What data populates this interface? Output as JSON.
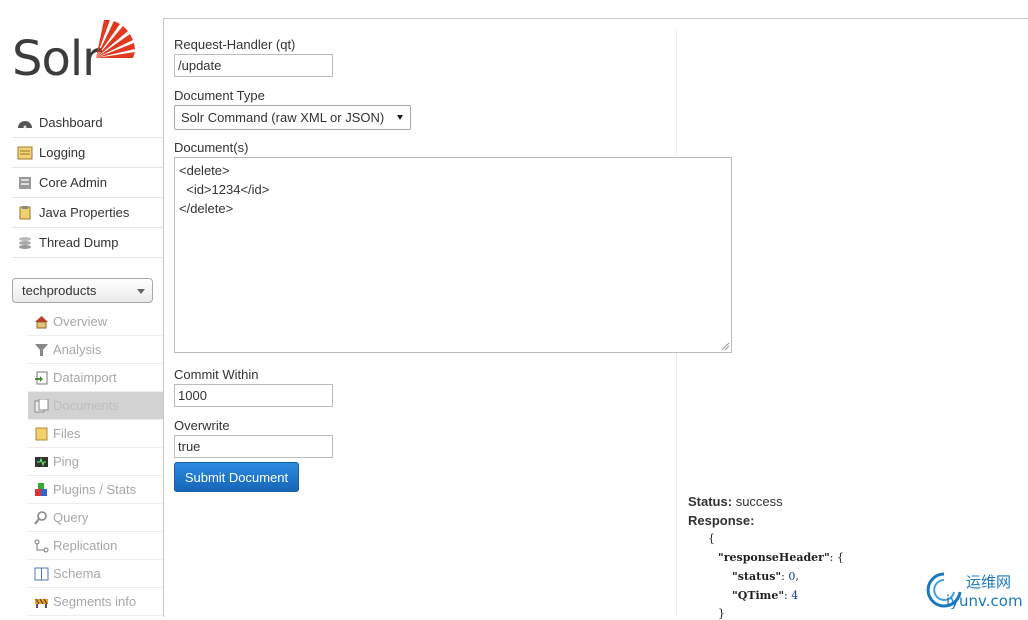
{
  "logo": {
    "text": "Solr"
  },
  "nav": [
    {
      "label": "Dashboard",
      "icon": "dashboard-icon"
    },
    {
      "label": "Logging",
      "icon": "logging-icon"
    },
    {
      "label": "Core Admin",
      "icon": "core-admin-icon"
    },
    {
      "label": "Java Properties",
      "icon": "java-properties-icon"
    },
    {
      "label": "Thread Dump",
      "icon": "thread-dump-icon"
    }
  ],
  "core_selector": {
    "value": "techproducts"
  },
  "core_nav": [
    {
      "label": "Overview",
      "icon": "home-icon"
    },
    {
      "label": "Analysis",
      "icon": "funnel-icon"
    },
    {
      "label": "Dataimport",
      "icon": "dataimport-icon"
    },
    {
      "label": "Documents",
      "icon": "documents-icon",
      "active": true
    },
    {
      "label": "Files",
      "icon": "folder-icon"
    },
    {
      "label": "Ping",
      "icon": "ping-icon"
    },
    {
      "label": "Plugins / Stats",
      "icon": "plugins-icon"
    },
    {
      "label": "Query",
      "icon": "query-icon"
    },
    {
      "label": "Replication",
      "icon": "replication-icon"
    },
    {
      "label": "Schema",
      "icon": "schema-icon"
    },
    {
      "label": "Segments info",
      "icon": "segments-icon"
    }
  ],
  "form": {
    "request_handler_label": "Request-Handler (qt)",
    "request_handler_value": "/update",
    "document_type_label": "Document Type",
    "document_type_value": "Solr Command (raw XML or JSON)",
    "documents_label": "Document(s)",
    "documents_lines": [
      "<delete>",
      "  <id>1234</id>",
      "</delete>"
    ],
    "commit_within_label": "Commit Within",
    "commit_within_value": "1000",
    "overwrite_label": "Overwrite",
    "overwrite_value": "true",
    "submit_label": "Submit Document"
  },
  "response": {
    "status_label": "Status:",
    "status_value": "success",
    "response_label": "Response:",
    "open_brace": "{",
    "header_key": "\"responseHeader\"",
    "header_open": ": {",
    "status_key": "\"status\"",
    "status_num": "0",
    "qtime_key": "\"QTime\"",
    "qtime_num": "4",
    "close_brace": "}"
  },
  "watermark": {
    "cn": "运维网",
    "en": "iyunv.com"
  },
  "colors": {
    "accent": "#1766b8",
    "logo": "#e0391f",
    "active_nav": "#d2d2d2"
  }
}
